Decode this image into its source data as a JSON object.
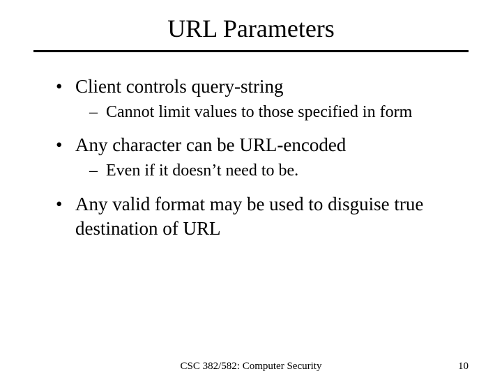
{
  "title": "URL Parameters",
  "bullets": {
    "b1": "Client controls query-string",
    "b1a": "Cannot limit values to those specified in form",
    "b2": "Any character can be URL-encoded",
    "b2a": "Even if it doesn’t need to be.",
    "b3": "Any valid format may be used to disguise true destination of URL"
  },
  "footer": {
    "center": "CSC 382/582: Computer Security",
    "page": "10"
  }
}
